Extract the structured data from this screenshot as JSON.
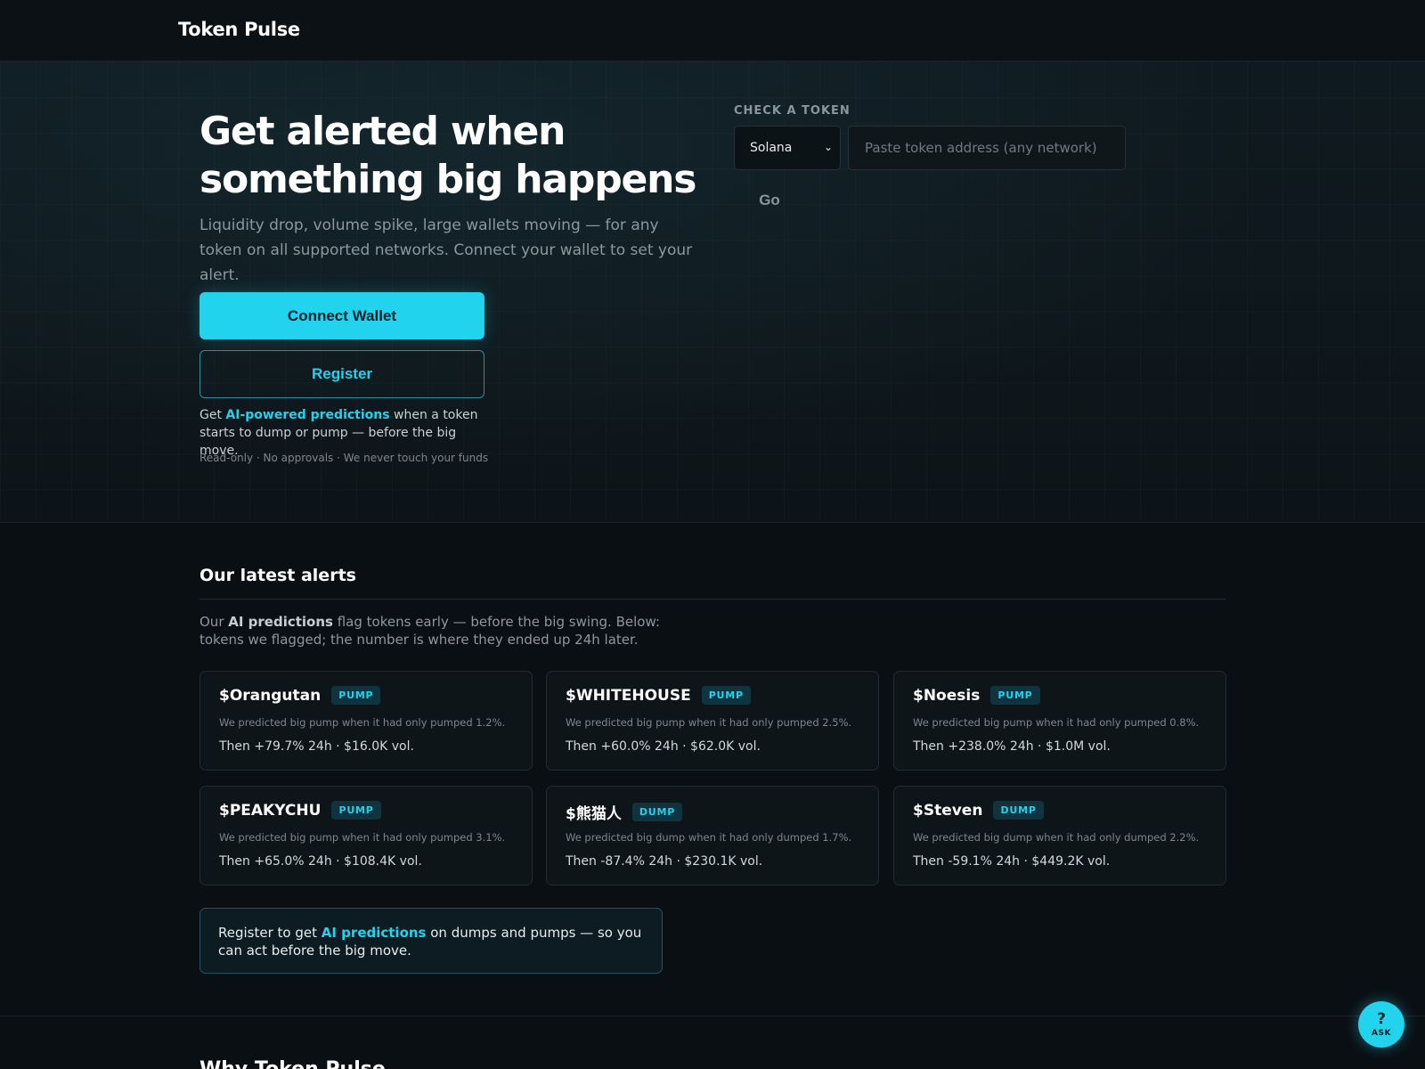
{
  "app": {
    "brand": "Token Pulse"
  },
  "hero": {
    "title": "Get alerted when something big happens",
    "subtitle": "Liquidity drop, volume spike, large wallets moving — for any token on all supported networks. Connect your wallet to set your alert.",
    "connect_label": "Connect Wallet",
    "register_label": "Register",
    "note_prefix": "Get ",
    "note_accent": "AI-powered predictions",
    "note_suffix": " when a token starts to dump or pump — before the big move.",
    "fine_print": "Read-only · No approvals · We never touch your funds"
  },
  "check": {
    "label": "CHECK A TOKEN",
    "network_selected": "Solana",
    "address_placeholder": "Paste token address (any network)",
    "go_label": "Go"
  },
  "alerts": {
    "title": "Our latest alerts",
    "desc_prefix": "Our ",
    "desc_bold": "AI predictions",
    "desc_suffix": " flag tokens early — before the big swing. Below: tokens we flagged; the number is where they ended up 24h later.",
    "cards": [
      {
        "ticker": "$Orangutan",
        "badge": "PUMP",
        "prediction": "We predicted big pump when it had only pumped 1.2%.",
        "result": "Then +79.7% 24h · $16.0K vol."
      },
      {
        "ticker": "$WHITEHOUSE",
        "badge": "PUMP",
        "prediction": "We predicted big pump when it had only pumped 2.5%.",
        "result": "Then +60.0% 24h · $62.0K vol."
      },
      {
        "ticker": "$Noesis",
        "badge": "PUMP",
        "prediction": "We predicted big pump when it had only pumped 0.8%.",
        "result": "Then +238.0% 24h · $1.0M vol."
      },
      {
        "ticker": "$PEAKYCHU",
        "badge": "PUMP",
        "prediction": "We predicted big pump when it had only pumped 3.1%.",
        "result": "Then +65.0% 24h · $108.4K vol."
      },
      {
        "ticker": "$熊猫人",
        "badge": "DUMP",
        "prediction": "We predicted big dump when it had only dumped 1.7%.",
        "result": "Then -87.4% 24h · $230.1K vol."
      },
      {
        "ticker": "$Steven",
        "badge": "DUMP",
        "prediction": "We predicted big dump when it had only dumped 2.2%.",
        "result": "Then -59.1% 24h · $449.2K vol."
      }
    ],
    "cta_prefix": "Register to get ",
    "cta_accent": "AI predictions",
    "cta_suffix": " on dumps and pumps — so you can act before the big move."
  },
  "next_section": {
    "title": "Why Token Pulse"
  },
  "ask": {
    "icon": "question-icon",
    "glyph": "?",
    "label": "ASK"
  },
  "colors": {
    "accent": "#22d3ee",
    "background": "#0a0f13"
  }
}
